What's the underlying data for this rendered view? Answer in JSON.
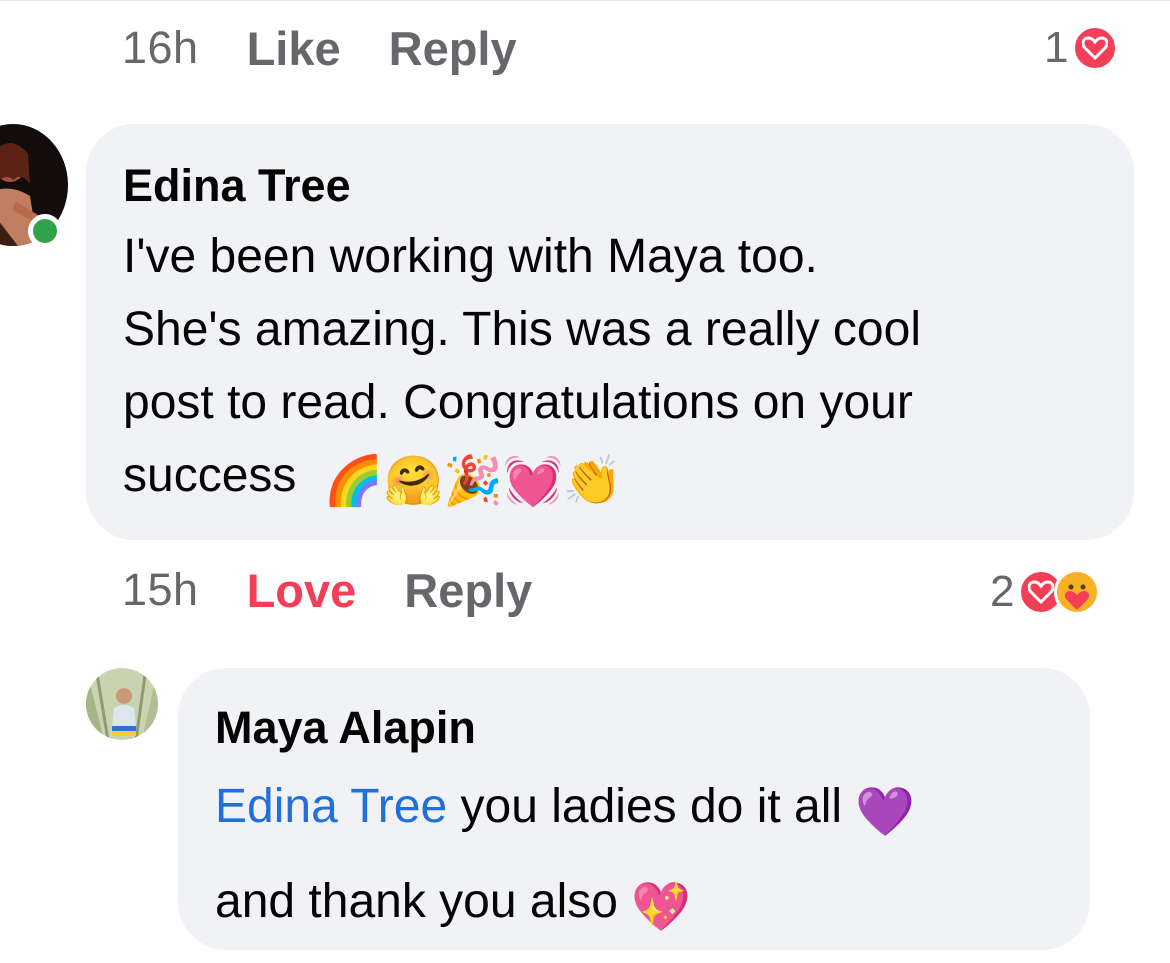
{
  "top_row": {
    "time": "16h",
    "like_label": "Like",
    "reply_label": "Reply",
    "reaction_count": "1",
    "reaction_icon": "heart-icon"
  },
  "comment_1": {
    "author": "Edina Tree",
    "online": true,
    "lines": [
      "I've been working with Maya too.",
      "She's amazing. This was a really cool",
      "post to read. Congratulations on your",
      "success"
    ],
    "emoji": [
      "🌈",
      "🤗",
      "🎉",
      "💓",
      "👏"
    ],
    "time": "15h",
    "love_label": "Love",
    "reply_label": "Reply",
    "reaction_count": "2",
    "reaction_icons": [
      "heart-icon",
      "care-icon"
    ]
  },
  "comment_2": {
    "author": "Maya Alapin",
    "mention": "Edina Tree",
    "line_1": " you ladies do it all ",
    "line_1_emoji": "💜",
    "line_2": "and thank you also ",
    "line_2_emoji": "💖"
  },
  "colors": {
    "bubble": "#f0f2f5",
    "meta_text": "#65676b",
    "love": "#f33e58",
    "mention": "#216fdb",
    "online": "#31a24c"
  }
}
